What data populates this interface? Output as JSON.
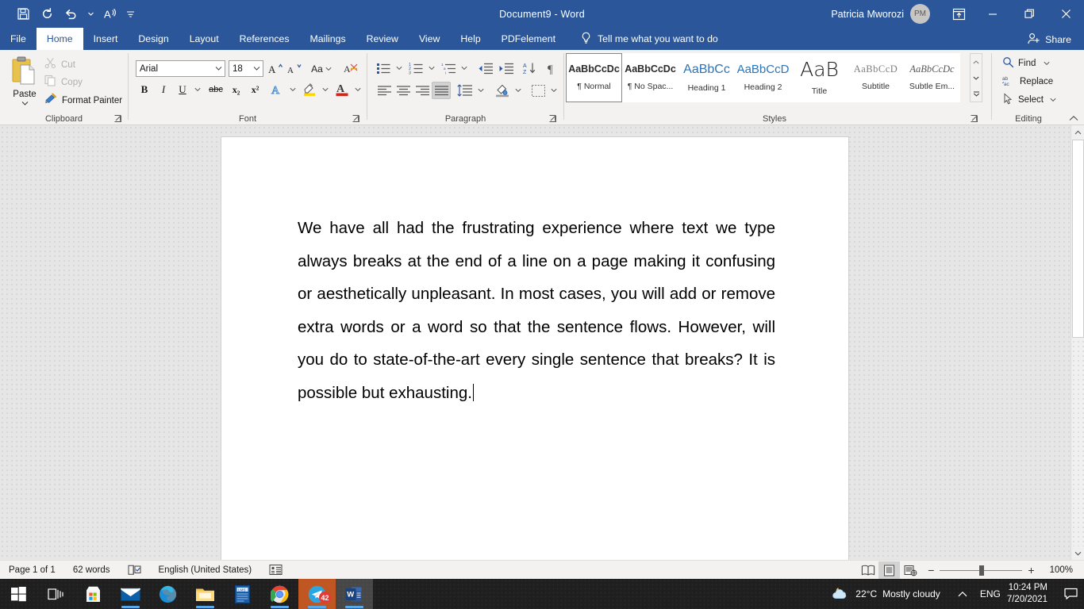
{
  "window": {
    "title": "Document9  -  Word",
    "account_name": "Patricia Mworozi",
    "account_initials": "PM",
    "accent_color": "#2b579a",
    "qat": [
      {
        "name": "save-icon",
        "label": "Save"
      },
      {
        "name": "repeat-icon",
        "label": "Repeat"
      },
      {
        "name": "undo-icon",
        "label": "Undo"
      },
      {
        "name": "undo-dropdown-icon",
        "label": "Undo options"
      },
      {
        "name": "read-aloud-icon",
        "label": "Read Aloud"
      },
      {
        "name": "customize-quick-access-toolbar-icon",
        "label": "Customize Quick Access Toolbar"
      }
    ],
    "ribbon_display_options": "Ribbon Display Options",
    "minimize": "Minimize",
    "restore": "Restore Down",
    "close": "Close"
  },
  "tabs": [
    {
      "label": "File",
      "active": false
    },
    {
      "label": "Home",
      "active": true
    },
    {
      "label": "Insert",
      "active": false
    },
    {
      "label": "Design",
      "active": false
    },
    {
      "label": "Layout",
      "active": false
    },
    {
      "label": "References",
      "active": false
    },
    {
      "label": "Mailings",
      "active": false
    },
    {
      "label": "Review",
      "active": false
    },
    {
      "label": "View",
      "active": false
    },
    {
      "label": "Help",
      "active": false
    },
    {
      "label": "PDFelement",
      "active": false
    }
  ],
  "tell_me": {
    "placeholder": "Tell me what you want to do",
    "icon": "lightbulb-icon"
  },
  "share": {
    "label": "Share",
    "icon": "share-person-icon"
  },
  "ribbon": {
    "groups": [
      {
        "name": "Clipboard"
      },
      {
        "name": "Font"
      },
      {
        "name": "Paragraph"
      },
      {
        "name": "Styles"
      },
      {
        "name": "Editing"
      }
    ],
    "clipboard": {
      "paste_label": "Paste",
      "cut_label": "Cut",
      "copy_label": "Copy",
      "format_painter_label": "Format Painter",
      "cut_enabled": false,
      "copy_enabled": false
    },
    "font": {
      "font_family_value": "Arial",
      "font_size_value": "18",
      "grow_font": "Increase Font Size",
      "shrink_font": "Decrease Font Size",
      "change_case": "Aa",
      "clear_formatting": "Clear All Formatting",
      "bold": "B",
      "italic": "I",
      "underline": "U",
      "strikethrough": "abc",
      "subscript": "x₂",
      "superscript": "x²",
      "text_effects": "Text Effects and Typography",
      "text_highlight": "Text Highlight Color",
      "font_color": "Font Color"
    },
    "paragraph": {
      "bullets": "Bullets",
      "numbering": "Numbering",
      "multilevel_list": "Multilevel List",
      "decrease_indent": "Decrease Indent",
      "increase_indent": "Increase Indent",
      "sort": "Sort",
      "show_marks": "Show/Hide ¶",
      "align_left": "Align Left",
      "center": "Center",
      "align_right": "Align Right",
      "justify": "Justify",
      "active_alignment": "Justify",
      "line_spacing": "Line and Paragraph Spacing",
      "shading": "Shading",
      "borders": "Borders"
    },
    "styles": {
      "items": [
        {
          "sample": "AaBbCcDc",
          "name": "¶ Normal",
          "active": true,
          "style": "normal"
        },
        {
          "sample": "AaBbCcDc",
          "name": "¶ No Spac...",
          "active": false,
          "style": "normal"
        },
        {
          "sample": "AaBbCc",
          "name": "Heading 1",
          "active": false,
          "style": "heading1"
        },
        {
          "sample": "AaBbCcD",
          "name": "Heading 2",
          "active": false,
          "style": "heading2"
        },
        {
          "sample": "AaB",
          "name": "Title",
          "active": false,
          "style": "title"
        },
        {
          "sample": "AaBbCcD",
          "name": "Subtitle",
          "active": false,
          "style": "subtitle"
        },
        {
          "sample": "AaBbCcDc",
          "name": "Subtle Em...",
          "active": false,
          "style": "subtle"
        }
      ],
      "scroll_up": "Scroll up",
      "scroll_down": "Scroll down",
      "more": "More"
    },
    "editing": {
      "find_label": "Find",
      "replace_label": "Replace",
      "select_label": "Select"
    },
    "collapse_ribbon": "Collapse the Ribbon"
  },
  "document": {
    "paragraph": "We have all had the frustrating experience where text we type always breaks at the end of a line on a page making it confusing or aesthetically unpleasant. In most cases, you will add or remove extra words or a word so that the sentence flows. However, will you do to state-of-the-art every single sentence that breaks? It is possible but exhausting.",
    "font_family_rendered": "Arial",
    "alignment": "justify"
  },
  "status_bar": {
    "page_info": "Page 1 of 1",
    "word_count": "62 words",
    "proofing_icon": "proofing-errors-icon",
    "language": "English (United States)",
    "accessibility_icon": "accessibility-checker-icon",
    "views": [
      {
        "name": "read-mode-view",
        "label": "Read Mode",
        "active": false
      },
      {
        "name": "print-layout-view",
        "label": "Print Layout",
        "active": true
      },
      {
        "name": "web-layout-view",
        "label": "Web Layout",
        "active": false
      }
    ],
    "zoom_out": "−",
    "zoom_in": "+",
    "zoom_level": "100%"
  },
  "taskbar": {
    "items": [
      {
        "name": "start-button",
        "label": "Start",
        "running": false,
        "active": false
      },
      {
        "name": "task-view-button",
        "label": "Task View",
        "running": false,
        "active": false
      },
      {
        "name": "microsoft-store-icon",
        "label": "Microsoft Store",
        "running": false,
        "active": false
      },
      {
        "name": "mail-icon",
        "label": "Mail",
        "running": true,
        "active": false
      },
      {
        "name": "microsoft-edge-icon",
        "label": "Microsoft Edge",
        "running": false,
        "active": false
      },
      {
        "name": "file-explorer-icon",
        "label": "File Explorer",
        "running": true,
        "active": false
      },
      {
        "name": "lms-app-icon",
        "label": "LMS",
        "running": false,
        "active": false
      },
      {
        "name": "google-chrome-icon",
        "label": "Google Chrome",
        "running": true,
        "active": false
      },
      {
        "name": "telegram-icon",
        "label": "Telegram",
        "running": true,
        "active": false,
        "badge": "42"
      },
      {
        "name": "word-icon",
        "label": "Word",
        "running": true,
        "active": true
      }
    ],
    "tray": {
      "weather_icon": "partly-cloudy-night-icon",
      "temperature": "22°C",
      "condition": "Mostly cloudy",
      "show_hidden_icons": "Show hidden icons",
      "language": "ENG",
      "time": "10:24 PM",
      "date": "7/20/2021",
      "action_center": "Notifications"
    }
  }
}
